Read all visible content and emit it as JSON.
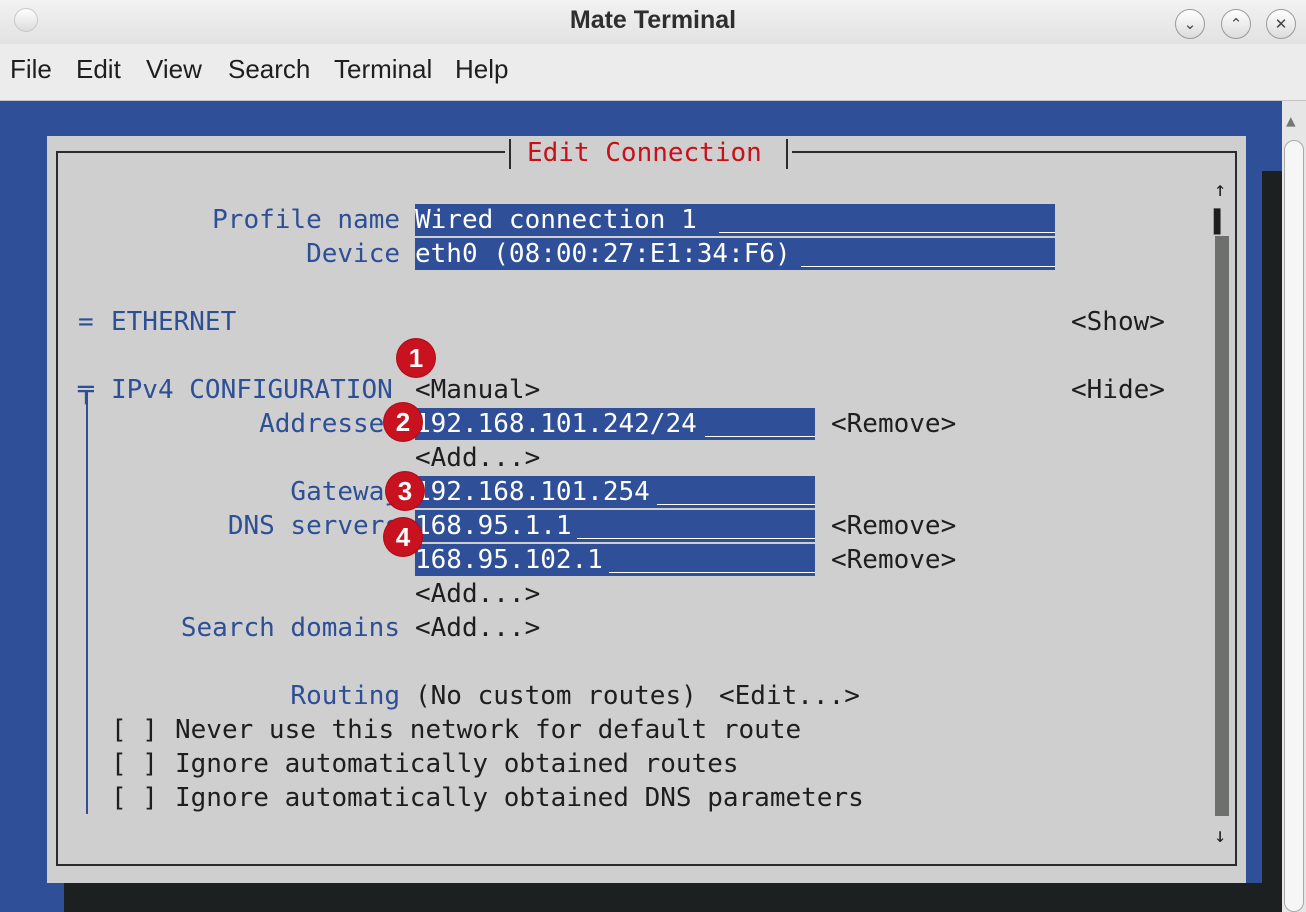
{
  "window": {
    "title": "Mate Terminal"
  },
  "menubar": [
    "File",
    "Edit",
    "View",
    "Search",
    "Terminal",
    "Help"
  ],
  "dialog": {
    "title": "Edit Connection",
    "profile_label": "Profile name",
    "profile_value": "Wired connection 1",
    "device_label": "Device",
    "device_value": "eth0 (08:00:27:E1:34:F6)",
    "ethernet": {
      "marker": "=",
      "label": "ETHERNET",
      "toggle": "<Show>"
    },
    "ipv4": {
      "marker": "╤",
      "label": "IPv4 CONFIGURATION",
      "mode": "<Manual>",
      "toggle": "<Hide>",
      "addresses_label": "Addresses",
      "addresses": [
        "192.168.101.242/24"
      ],
      "add": "<Add...>",
      "remove": "<Remove>",
      "gateway_label": "Gateway",
      "gateway": "192.168.101.254",
      "dns_label": "DNS servers",
      "dns": [
        "168.95.1.1",
        "168.95.102.1"
      ],
      "search_label": "Search domains",
      "routing_label": "Routing",
      "routing_value": "(No custom routes)",
      "routing_edit": "<Edit...>",
      "checkboxes": [
        {
          "box": "[ ]",
          "label": "Never use this network for default route",
          "checked": false
        },
        {
          "box": "[ ]",
          "label": "Ignore automatically obtained routes",
          "checked": false
        },
        {
          "box": "[ ]",
          "label": "Ignore automatically obtained DNS parameters",
          "checked": false
        }
      ]
    },
    "scroll_up": "↑",
    "scroll_down": "↓",
    "scroll_thumb": "▌"
  },
  "callouts": [
    "1",
    "2",
    "3",
    "4"
  ],
  "colors": {
    "terminal_blue": "#2f4f98",
    "label_blue": "#2d4f96",
    "title_red": "#c8101a",
    "callout_red": "#c8121f"
  }
}
